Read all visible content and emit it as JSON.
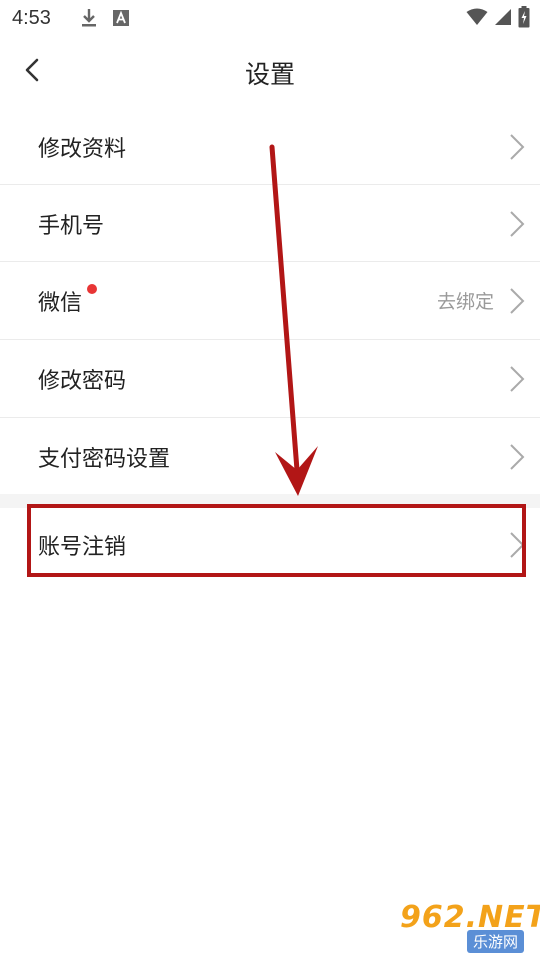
{
  "status_bar": {
    "time": "4:53",
    "icons": [
      "download-icon",
      "a-notification-icon",
      "wifi-icon",
      "signal-icon",
      "battery-icon"
    ]
  },
  "header": {
    "title": "设置",
    "back_icon": "chevron-left-icon"
  },
  "settings": {
    "items": [
      {
        "label": "修改资料"
      },
      {
        "label": "手机号"
      },
      {
        "label": "微信",
        "value": "去绑定",
        "badge": "red-dot"
      },
      {
        "label": "修改密码"
      },
      {
        "label": "支付密码设置"
      },
      {
        "label": "账号注销"
      }
    ]
  },
  "annotation": {
    "color": "#b21616",
    "arrow": "pointing-down-to-account-deletion",
    "highlight": "account-deletion-row"
  },
  "watermark": {
    "main": "962.NET",
    "sub": "乐游网"
  },
  "colors": {
    "background": "#ffffff",
    "section_gap": "#f4f4f4",
    "divider": "#ebebeb",
    "secondary_text": "#9a9a9a",
    "badge_red": "#e83535"
  }
}
